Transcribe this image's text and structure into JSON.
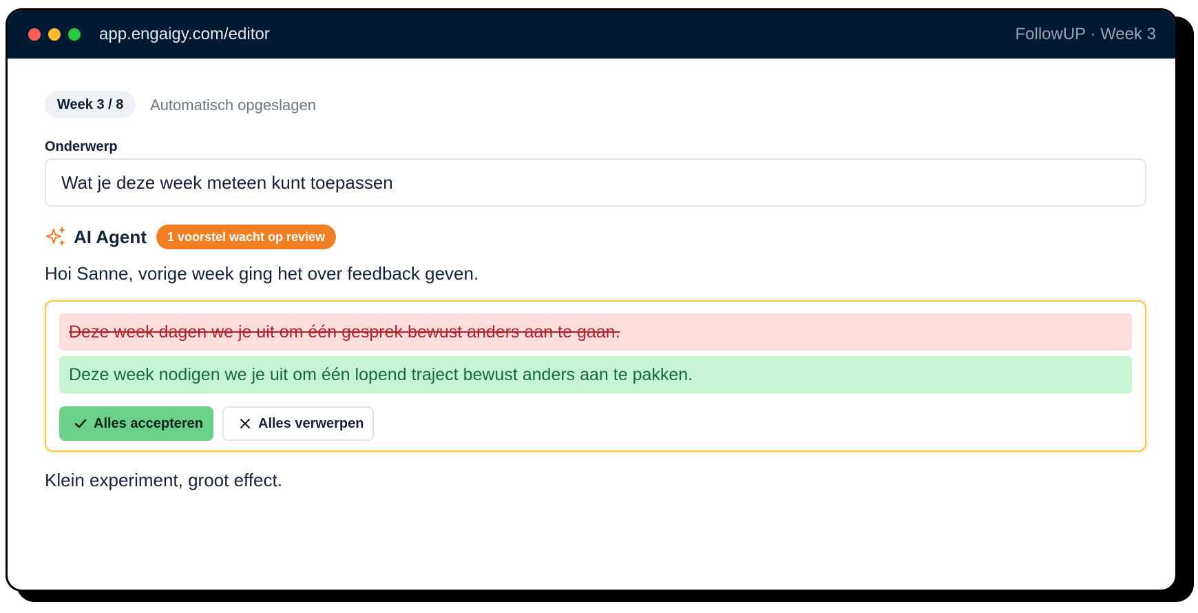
{
  "window": {
    "url": "app.engaigy.com/editor",
    "app_label": "FollowUP · Week 3"
  },
  "status": {
    "week_pill": "Week 3 / 8",
    "autosave": "Automatisch opgeslagen"
  },
  "subject": {
    "label": "Onderwerp",
    "value": "Wat je deze week meteen kunt toepassen"
  },
  "agent": {
    "icon": "sparkle-icon",
    "title": "AI Agent",
    "badge": "1 voorstel wacht op review",
    "badge_color": "#f07f23"
  },
  "body": {
    "intro": "Hoi Sanne, vorige week ging het over feedback geven.",
    "closing": "Klein experiment, groot effect."
  },
  "suggestion": {
    "removed_text": "Deze week dagen we je uit om één gesprek bewust anders aan te gaan.",
    "added_text": "Deze week nodigen we je uit om één lopend traject bewust anders aan te pakken.",
    "accept_label": "Alles accepteren",
    "reject_label": "Alles verwerpen",
    "accept_icon": "check-icon",
    "reject_icon": "close-icon"
  },
  "colors": {
    "titlebar": "#011a33",
    "accept": "#6dd08a",
    "removed_bg": "#fddedd",
    "added_bg": "#c6f4d3",
    "suggestion_border": "#f6c651"
  }
}
